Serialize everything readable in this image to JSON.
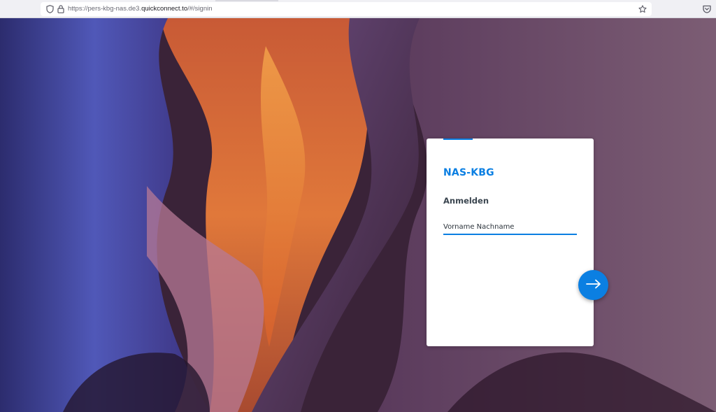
{
  "browser": {
    "url_prefix": "https://pers-kbg-nas.de3.",
    "url_host": "quickconnect.to",
    "url_suffix": "/#/signin"
  },
  "login": {
    "server_name": "NAS-KBG",
    "heading": "Anmelden",
    "username_value": "Vorname Nachname"
  },
  "icons": {
    "shield": "shield-icon",
    "lock": "lock-icon",
    "bookmark": "bookmark-star-icon",
    "pocket": "pocket-icon",
    "next": "arrow-right-icon"
  },
  "colors": {
    "accent": "#0b7fe2",
    "browser_bar": "#f0f0f4"
  }
}
